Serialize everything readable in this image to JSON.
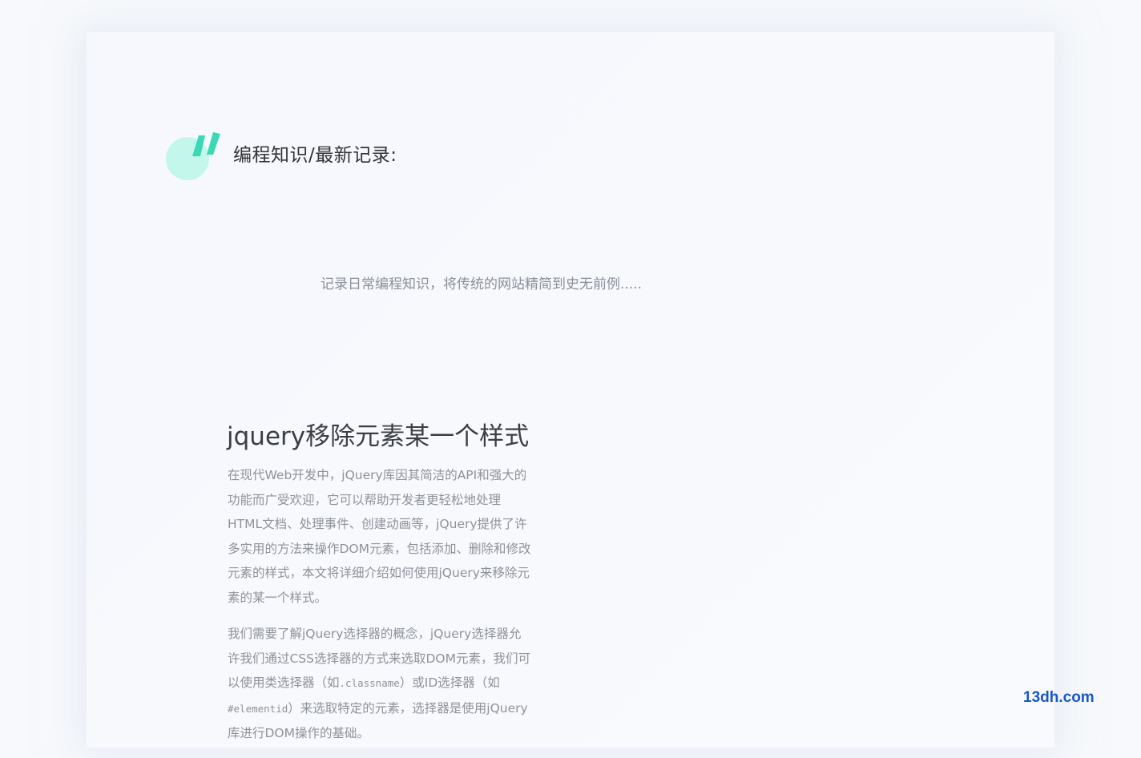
{
  "section": {
    "title": "编程知识/最新记录:",
    "tagline": "记录日常编程知识，将传统的网站精简到史无前例....."
  },
  "article": {
    "title": "jquery移除元素某一个样式",
    "para1": "在现代Web开发中，jQuery库因其简洁的API和强大的功能而广受欢迎，它可以帮助开发者更轻松地处理HTML文档、处理事件、创建动画等，jQuery提供了许多实用的方法来操作DOM元素，包括添加、删除和修改元素的样式，本文将详细介绍如何使用jQuery来移除元素的某一个样式。",
    "para2_a": "我们需要了解jQuery选择器的概念，jQuery选择器允许我们通过CSS选择器的方式来选取DOM元素，我们可以使用类选择器（如",
    "para2_code1": ".classname",
    "para2_b": "）或ID选择器（如",
    "para2_code2": "#elementid",
    "para2_c": "）来选取特定的元素，选择器是使用jQuery库进行DOM操作的基础。"
  },
  "watermark": "13dh.com",
  "colors": {
    "quote_circle": "#c4f7ec",
    "quote_marks": "#3ad9b4",
    "watermark": "#1a56c8"
  },
  "icons": {
    "quote": "quote-mark-icon"
  }
}
